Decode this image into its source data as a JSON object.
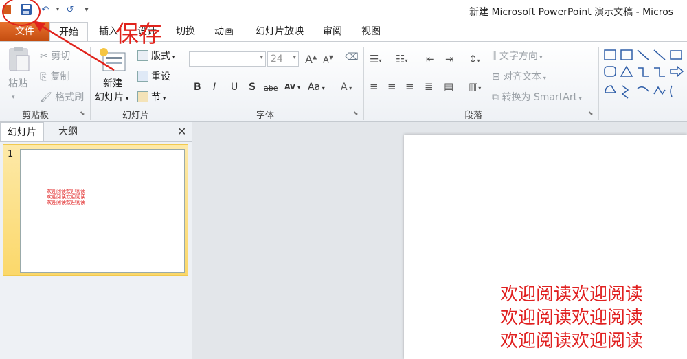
{
  "window": {
    "title": "新建 Microsoft PowerPoint 演示文稿 - Micros"
  },
  "tabs": [
    "文件",
    "开始",
    "插入",
    "设计",
    "切换",
    "动画",
    "幻灯片放映",
    "审阅",
    "视图"
  ],
  "ribbon": {
    "clipboard": {
      "label": "剪贴板",
      "paste": "粘贴",
      "cut": "剪切",
      "copy": "复制",
      "format_painter": "格式刷"
    },
    "slides": {
      "label": "幻灯片",
      "new_slide_1": "新建",
      "new_slide_2": "幻灯片",
      "layout": "版式",
      "reset": "重设",
      "section": "节"
    },
    "font": {
      "label": "字体",
      "font_name": "",
      "font_size": "24",
      "bold": "B",
      "italic": "I",
      "underline": "U",
      "shadow": "S",
      "strike": "abe",
      "spacing": "AV",
      "case": "Aa",
      "color": "A",
      "grow": "A",
      "shrink": "A"
    },
    "paragraph": {
      "label": "段落",
      "text_direction": "文字方向",
      "align_text": "对齐文本",
      "smartart": "转换为 SmartArt"
    }
  },
  "panel": {
    "tab_slides": "幻灯片",
    "tab_outline": "大纲",
    "close": "✕",
    "slide_number": "1",
    "thumb_lines": [
      "欢迎阅读欢迎阅读",
      "欢迎阅读欢迎阅读",
      "欢迎阅读欢迎阅读"
    ]
  },
  "slide": {
    "lines": [
      "欢迎阅读欢迎阅读",
      "欢迎阅读欢迎阅读",
      "欢迎阅读欢迎阅读"
    ]
  },
  "annotation": {
    "text": "保存",
    "color": "#e0231c"
  },
  "colors": {
    "file_tab": "#d35a1c",
    "accent_red": "#e02020",
    "selected_thumb": "#fbd86a"
  },
  "icons": {
    "save": "save-icon",
    "undo": "undo-icon",
    "redo": "redo-icon"
  }
}
